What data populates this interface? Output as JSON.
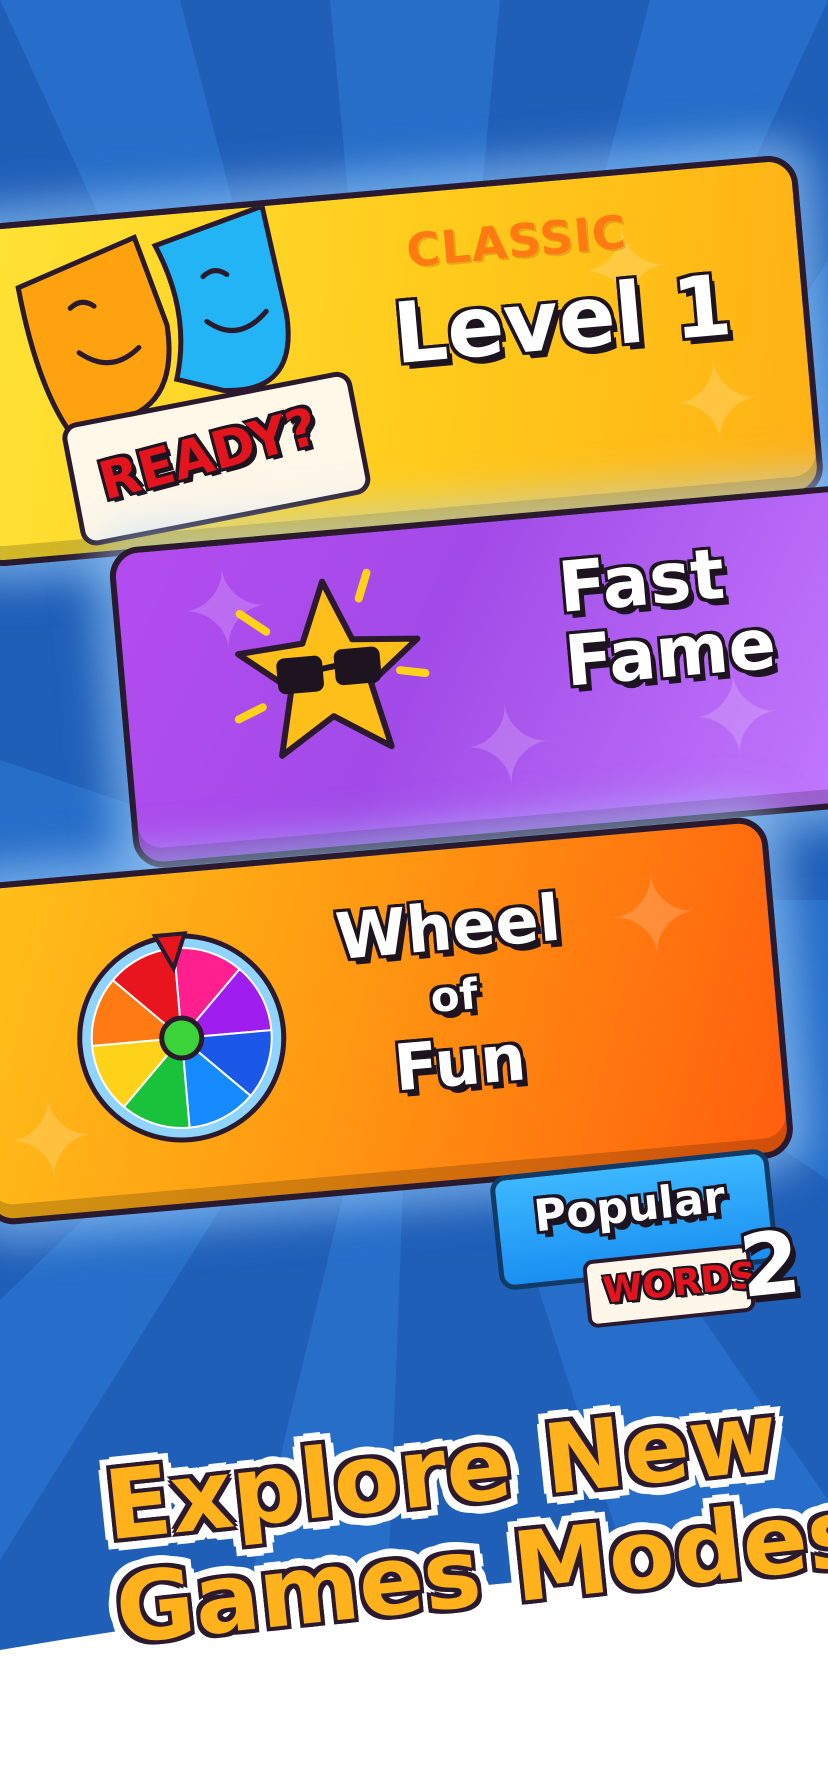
{
  "modes": {
    "classic": {
      "label": "CLASSIC",
      "level": "Level 1",
      "badge": "READY?"
    },
    "fast_fame": {
      "line1": "Fast",
      "line2": "Fame"
    },
    "wheel_of_fun": {
      "line1": "Wheel",
      "line2": "of",
      "line3": "Fun"
    }
  },
  "logo": {
    "line1": "Popular",
    "line2": "WORDS",
    "number": "2"
  },
  "headline": {
    "line1": "Explore New",
    "line2": "Games Modes"
  },
  "colors": {
    "background": "#1f5fb8",
    "classic_card": "#ffcb1c",
    "fast_fame_card": "#a24be8",
    "wheel_card": "#ff9a12",
    "headline": "#ffb21b",
    "badge_red": "#e2141e"
  },
  "icons": {
    "classic": "masks-icon",
    "fast_fame": "star-sunglasses-icon",
    "wheel_of_fun": "prize-wheel-icon"
  }
}
